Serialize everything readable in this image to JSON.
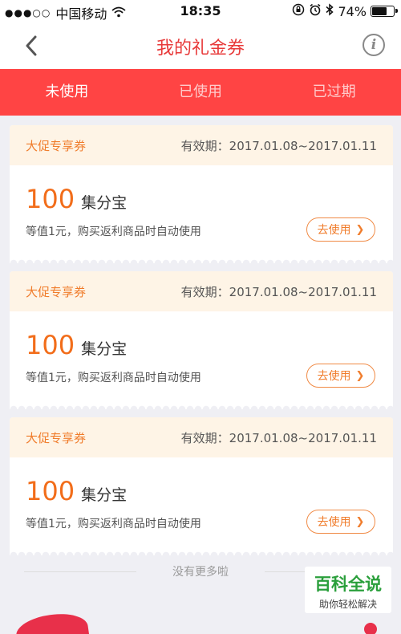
{
  "status_bar": {
    "signal": "●●●○○",
    "carrier": "中国移动",
    "time": "18:35",
    "battery": "74%",
    "battery_level": 0.74
  },
  "nav": {
    "title": "我的礼金券",
    "info_glyph": "i"
  },
  "tabs": [
    {
      "label": "未使用",
      "active": true
    },
    {
      "label": "已使用",
      "active": false
    },
    {
      "label": "已过期",
      "active": false
    }
  ],
  "coupons": [
    {
      "tag": "大促专享券",
      "validity": "有效期：2017.01.08~2017.01.11",
      "amount": "100",
      "unit": "集分宝",
      "desc": "等值1元，购买返利商品时自动使用",
      "button": "去使用"
    },
    {
      "tag": "大促专享券",
      "validity": "有效期：2017.01.08~2017.01.11",
      "amount": "100",
      "unit": "集分宝",
      "desc": "等值1元，购买返利商品时自动使用",
      "button": "去使用"
    },
    {
      "tag": "大促专享券",
      "validity": "有效期：2017.01.08~2017.01.11",
      "amount": "100",
      "unit": "集分宝",
      "desc": "等值1元，购买返利商品时自动使用",
      "button": "去使用"
    }
  ],
  "footer": {
    "no_more": "没有更多啦"
  },
  "watermark": {
    "title": "百科全说",
    "subtitle": "助你轻松解决"
  },
  "colors": {
    "accent_red": "#ff4444",
    "title_red": "#e83a3a",
    "coupon_orange": "#f26d1a",
    "coupon_header_bg": "#fef4e6"
  }
}
